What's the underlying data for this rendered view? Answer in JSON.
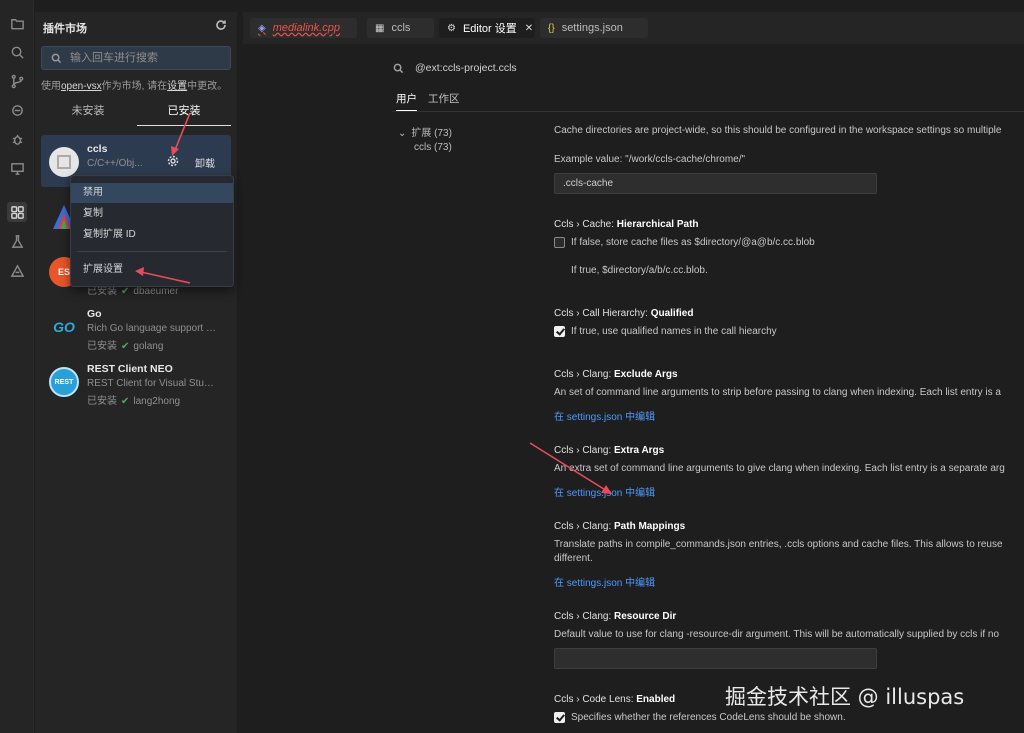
{
  "sidebar": {
    "title": "插件市场",
    "search_placeholder": "输入回车进行搜索",
    "hint_prefix": "使用",
    "hint_link": "open-vsx",
    "hint_mid": "作为市场, 请在",
    "hint_link2": "设置",
    "hint_suffix": "中更改。",
    "tab_not_installed": "未安装",
    "tab_installed": "已安装",
    "extensions": [
      {
        "name": "ccls",
        "desc": "C/C++/Obj...",
        "meta": "",
        "publisher": "",
        "logo_text": ""
      },
      {
        "name": "",
        "desc": "",
        "meta": "",
        "publisher": "",
        "logo_text": ""
      },
      {
        "name": "",
        "desc": "",
        "meta": "已安装",
        "publisher": "dbaeumer",
        "logo_text": "ES"
      },
      {
        "name": "Go",
        "desc": "Rich Go language support f...",
        "meta": "已安装",
        "publisher": "golang",
        "logo_text": "GO"
      },
      {
        "name": "REST Client NEO",
        "desc": "REST Client for Visual Studi...",
        "meta": "已安装",
        "publisher": "lang2hong",
        "logo_text": "REST"
      }
    ],
    "uninstall_label": "卸载",
    "context_menu": [
      "禁用",
      "复制",
      "复制扩展 ID",
      "扩展设置"
    ]
  },
  "tabs": [
    {
      "label": "medialink.cpp",
      "icon": "cpp-icon"
    },
    {
      "label": "ccls",
      "icon": "extensions-icon"
    },
    {
      "label": "Editor 设置",
      "icon": "gear-icon"
    },
    {
      "label": "settings.json",
      "icon": "json-icon"
    }
  ],
  "settings": {
    "search_value": "@ext:ccls-project.ccls",
    "tab_user": "用户",
    "tab_workspace": "工作区",
    "toc_extensions": "扩展 (73)",
    "toc_ccls": "ccls (73)",
    "cache_desc": "Cache directories are project-wide, so this should be configured in the workspace settings so multiple",
    "example_value": "Example value: \"/work/ccls-cache/chrome/\"",
    "cache_dir_value": ".ccls-cache",
    "hp_prefix": "Ccls › Cache: ",
    "hp_name": "Hierarchical Path",
    "hp_desc": "If false, store cache files as $directory/@a@b/c.cc.blob",
    "hp_desc2": "If true, $directory/a/b/c.cc.blob.",
    "ch_prefix": "Ccls › Call Hierarchy: ",
    "ch_name": "Qualified",
    "ch_desc": "If true, use qualified names in the call hiearchy",
    "ea_prefix": "Ccls › Clang: ",
    "ea_name": "Exclude Args",
    "ea_desc": "An set of command line arguments to strip before passing to clang when indexing. Each list entry is a",
    "edit_link": "在 settings.json 中编辑",
    "xa_prefix": "Ccls › Clang: ",
    "xa_name": "Extra Args",
    "xa_desc": "An extra set of command line arguments to give clang when indexing. Each list entry is a separate arg",
    "pm_prefix": "Ccls › Clang: ",
    "pm_name": "Path Mappings",
    "pm_desc": "Translate paths in compile_commands.json entries, .ccls options and cache files. This allows to reuse",
    "pm_desc2": "different.",
    "rd_prefix": "Ccls › Clang: ",
    "rd_name": "Resource Dir",
    "rd_desc": "Default value to use for clang -resource-dir argument. This will be automatically supplied by ccls if no",
    "cl_prefix": "Ccls › Code Lens: ",
    "cl_name": "Enabled",
    "cl_desc": "Specifies whether the references CodeLens should be shown."
  },
  "watermark": "掘金技术社区 @ illuspas"
}
